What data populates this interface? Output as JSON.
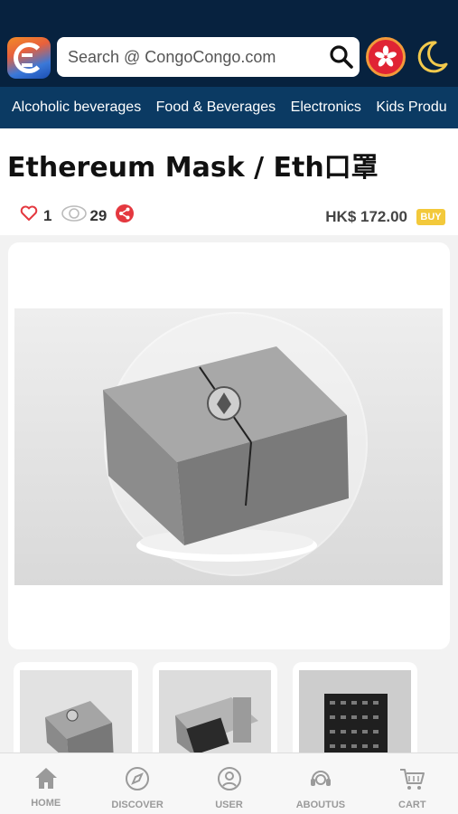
{
  "header": {
    "search_placeholder": "Search @ CongoCongo.com"
  },
  "categories": [
    {
      "label": "Alcoholic beverages"
    },
    {
      "label": "Food & Beverages"
    },
    {
      "label": "Electronics"
    },
    {
      "label": "Kids Produ"
    }
  ],
  "product": {
    "title": "Ethereum Mask / Eth口罩",
    "likes": "1",
    "views": "29",
    "price": "HK$ 172.00",
    "buy_label": "BUY"
  },
  "bottom_nav": [
    {
      "label": "HOME",
      "icon": "home-icon"
    },
    {
      "label": "DISCOVER",
      "icon": "compass-icon"
    },
    {
      "label": "USER",
      "icon": "user-icon"
    },
    {
      "label": "ABOUTUS",
      "icon": "headset-icon"
    },
    {
      "label": "CART",
      "icon": "cart-icon"
    }
  ],
  "colors": {
    "header_bg": "#07223f",
    "category_bar_bg": "#0b3a63",
    "like_heart": "#e4383f",
    "share": "#e4383f",
    "buy_badge": "#f3c93b"
  }
}
